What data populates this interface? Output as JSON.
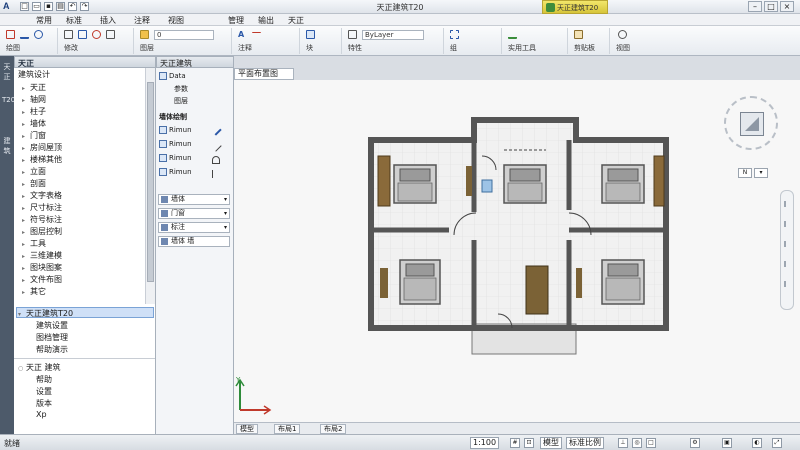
{
  "window": {
    "app_logo": "A",
    "title": "天正建筑T20",
    "brand_tab": "天正建筑T20"
  },
  "menus": [
    "常用",
    "标准",
    "插入",
    "注释",
    "视图",
    "管理",
    "输出",
    "天正"
  ],
  "ribbon": {
    "group_labels": [
      "绘图",
      "修改",
      "图层",
      "注释",
      "块",
      "特性",
      "组",
      "实用工具",
      "剪贴板",
      "视图"
    ],
    "layer_combo": "0",
    "color_combo": "ByLayer"
  },
  "palette": {
    "side_tabs": [
      "天正",
      "T20",
      "建筑"
    ],
    "title": "天正",
    "tree_header": "建筑设计",
    "tree_items": [
      "天正",
      "轴网",
      "柱子",
      "墙体",
      "门窗",
      "房间屋顶",
      "楼梯其他",
      "立面",
      "剖面",
      "文字表格",
      "尺寸标注",
      "符号标注",
      "图层控制",
      "工具",
      "三维建模",
      "图块图案",
      "文件布图",
      "其它"
    ],
    "selected_item": "天正建筑T20",
    "lower_items": [
      "建筑设置",
      "图档管理",
      "帮助演示"
    ],
    "bottom_group": "天正 建筑",
    "bottom_items": [
      "帮助",
      "设置",
      "版本",
      "Xp"
    ]
  },
  "tools": {
    "header": "天正建筑",
    "top_items": [
      "Data",
      "参数",
      "图层"
    ],
    "section": "墙体绘制",
    "grid_items": [
      "Rimun",
      "Rimun",
      "Rimun",
      "Rimun"
    ],
    "combos": [
      "墙体",
      "门窗",
      "标注"
    ],
    "last_combo": "墙体 墙"
  },
  "drawing": {
    "doc_tab": "平面布置图",
    "vc_btn": "N",
    "coord_label": "Y"
  },
  "layout_tabs": [
    "模型",
    "布局1",
    "布局2"
  ],
  "status": {
    "left_text": "就绪",
    "coord_label": "1:100",
    "mode_label": "模型",
    "scale_label": "标准比例"
  }
}
